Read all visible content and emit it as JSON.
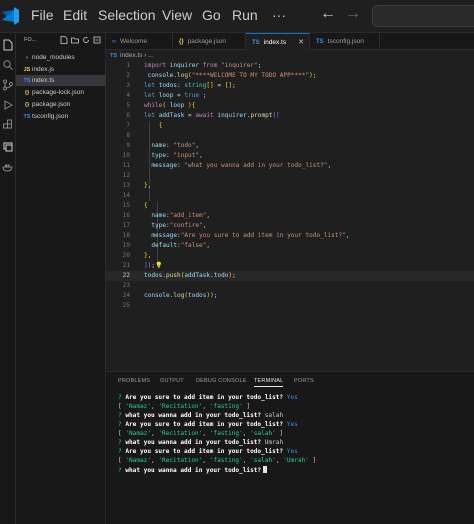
{
  "menu": [
    "File",
    "Edit",
    "Selection",
    "View",
    "Go",
    "Run",
    "···"
  ],
  "nav": {
    "back": "←",
    "forward": "→"
  },
  "explorer": {
    "title": "FO...",
    "files": [
      {
        "icon": "›",
        "name": "node_modules"
      },
      {
        "icon": "JS",
        "name": "index.js"
      },
      {
        "icon": "TS",
        "name": "index.ts"
      },
      {
        "icon": "{}",
        "name": "package-lock.json"
      },
      {
        "icon": "{}",
        "name": "package.json"
      },
      {
        "icon": "TS",
        "name": "tsconfig.json"
      }
    ]
  },
  "tabs": [
    {
      "icon": "‹›",
      "label": "Welcome"
    },
    {
      "icon": "{}",
      "label": "package.json"
    },
    {
      "icon": "TS",
      "label": "index.ts"
    },
    {
      "icon": "TS",
      "label": "tsconfig.json"
    }
  ],
  "breadcrumb": {
    "icon": "TS",
    "label": "index.ts",
    "sep": "›",
    "tail": "..."
  },
  "code": [
    {
      "n": "1",
      "text": "import inquirer from \"inquirer\";"
    },
    {
      "n": "2",
      "text": " console.log(\"****WELCOME TO MY TODO APP****\");"
    },
    {
      "n": "3",
      "text": "let todos: string[] = [];"
    },
    {
      "n": "4",
      "text": "let loop = true ;"
    },
    {
      "n": "5",
      "text": "while( loop ){"
    },
    {
      "n": "6",
      "text": "let addTask = await inquirer.prompt(["
    },
    {
      "n": "7",
      "text": "    {"
    },
    {
      "n": "8",
      "text": ""
    },
    {
      "n": "9",
      "text": "  name: \"todo\","
    },
    {
      "n": "10",
      "text": "  type: \"input\","
    },
    {
      "n": "11",
      "text": "  message: \"what you wanna add in your todo_list?\","
    },
    {
      "n": "12",
      "text": ""
    },
    {
      "n": "13",
      "text": "},"
    },
    {
      "n": "14",
      "text": ""
    },
    {
      "n": "15",
      "text": "{"
    },
    {
      "n": "16",
      "text": "  name:\"add_item\","
    },
    {
      "n": "17",
      "text": "  type:\"confire\","
    },
    {
      "n": "18",
      "text": "  message:\"Are you sure to add item in your todo_list?\","
    },
    {
      "n": "19",
      "text": "  default:\"false\","
    },
    {
      "n": "20",
      "text": "},"
    },
    {
      "n": "21",
      "text": "]);"
    },
    {
      "n": "22",
      "text": "todos.push(addTask.todo);"
    },
    {
      "n": "23",
      "text": ""
    },
    {
      "n": "24",
      "text": "console.log(todos));"
    },
    {
      "n": "25",
      "text": ""
    }
  ],
  "panel": {
    "tabs": [
      "PROBLEMS",
      "OUTPUT",
      "DEBUG CONSOLE",
      "TERMINAL",
      "PORTS"
    ],
    "active_tab": "TERMINAL",
    "lines": [
      {
        "mark": "?",
        "prompt": "Are you sure to add item in your todo_list?",
        "answer": "Yes"
      },
      {
        "array": "[ 'Namaz', 'Recitation', 'fasting' ]"
      },
      {
        "mark": "?",
        "prompt": "what you wanna add in your todo_list?",
        "answer": "salah"
      },
      {
        "mark": "?",
        "prompt": "Are you sure to add item in your todo_list?",
        "answer": "Yes"
      },
      {
        "array": "[ 'Namaz', 'Recitation', 'fasting', 'salah' ]"
      },
      {
        "mark": "?",
        "prompt": "what you wanna add in your todo_list?",
        "answer": "Umrah"
      },
      {
        "mark": "?",
        "prompt": "Are you sure to add item in your todo_list?",
        "answer": "Yes"
      },
      {
        "array": "[ 'Namaz', 'Recitation', 'fasting', 'salah', 'Umrah' ]"
      },
      {
        "mark": "?",
        "prompt": "what you wanna add in your todo_list?",
        "answer": ""
      }
    ]
  },
  "colors": {
    "accent": "#0078d4",
    "prompt_mark": "#23d18b",
    "answer": "#3b8eea",
    "editor_bg": "#1f1f1f",
    "sidebar_bg": "#181818"
  }
}
